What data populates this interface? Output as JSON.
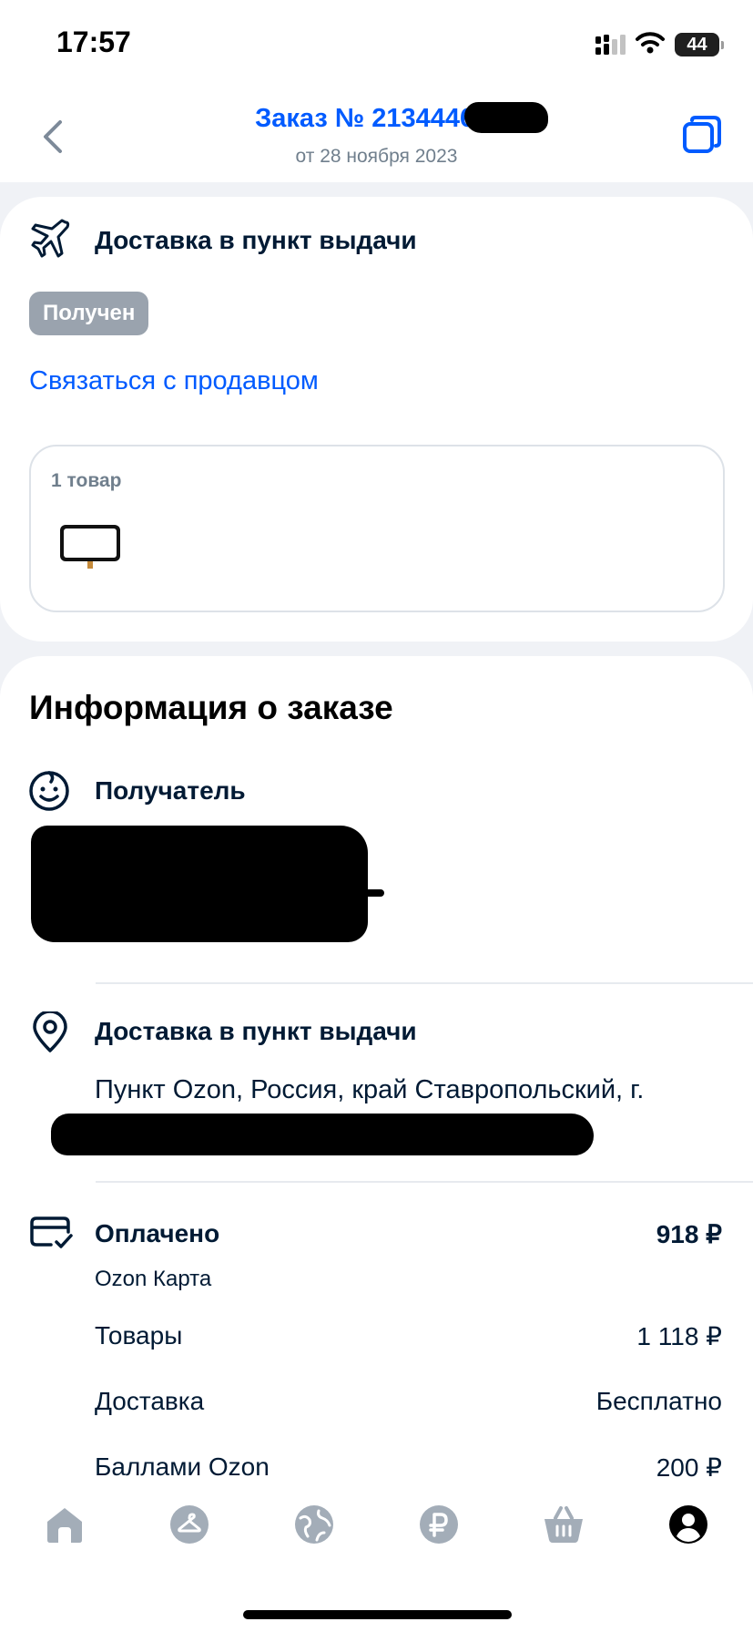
{
  "status_bar": {
    "time": "17:57",
    "battery": "44",
    "icons": [
      "cellular-signal-icon",
      "wifi-icon",
      "battery-icon"
    ]
  },
  "header": {
    "title": "Заказ № 21344468-",
    "subtitle": "от 28 ноября 2023",
    "icons": [
      "back-chevron-icon",
      "copy-icon"
    ]
  },
  "status_card": {
    "delivery_type": "Доставка в пункт выдачи",
    "status_badge": "Получен",
    "contact_link": "Связаться с продавцом",
    "items_count": "1 товар",
    "icons": [
      "airplane-icon"
    ]
  },
  "order_info": {
    "section_title": "Информация о заказе",
    "recipient": {
      "label": "Получатель",
      "icon": "smiley-face-icon"
    },
    "delivery": {
      "label": "Доставка в пункт выдачи",
      "address": "Пункт Ozon, Россия, край Ставропольский, г.",
      "icon": "map-pin-icon"
    },
    "payment": {
      "label": "Оплачено",
      "amount": "918 ₽",
      "method": "Ozon Карта",
      "icon": "credit-card-check-icon"
    },
    "breakdown": [
      {
        "label": "Товары",
        "value": "1 118 ₽"
      },
      {
        "label": "Доставка",
        "value": "Бесплатно"
      },
      {
        "label": "Баллами Ozon",
        "value": "200 ₽"
      }
    ]
  },
  "tab_bar": {
    "tabs": [
      "home-icon",
      "hanger-icon",
      "globe-icon",
      "ruble-icon",
      "basket-icon",
      "profile-icon"
    ],
    "active_tab": "profile-icon"
  },
  "colors": {
    "accent": "#005bff",
    "badge_bg": "#9aa3ae",
    "text": "#001a34",
    "muted": "#707f8d",
    "page_bg": "#f0f2f6",
    "tab_inactive": "#a3adb8"
  }
}
